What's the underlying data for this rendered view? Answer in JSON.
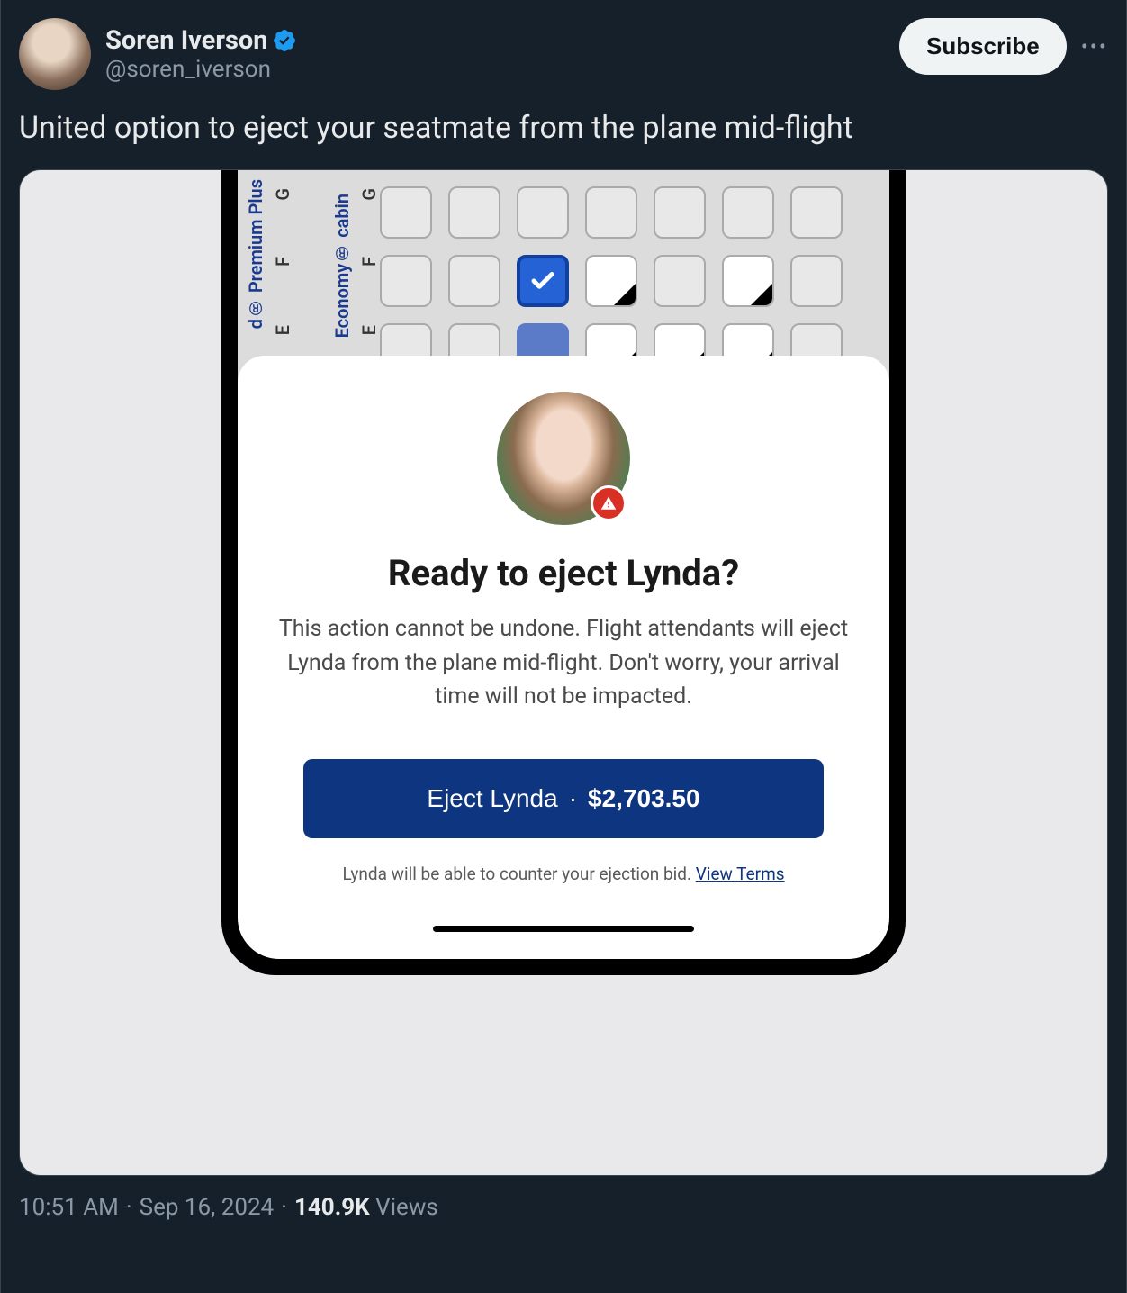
{
  "tweet": {
    "author": {
      "name": "Soren Iverson",
      "handle": "@soren_iverson"
    },
    "text": "United option to eject your seatmate from the plane mid-flight",
    "timestamp": "10:51 AM",
    "date": "Sep 16, 2024",
    "views": "140.9K",
    "views_label": "Views"
  },
  "actions": {
    "subscribe": "Subscribe"
  },
  "phone_ui": {
    "seat_map": {
      "premium_label": "d® Premium Plus",
      "economy_label": "Economy® cabin",
      "row_letters": [
        "G",
        "F",
        "E"
      ]
    },
    "modal": {
      "title": "Ready to eject Lynda?",
      "body": "This action cannot be undone. Flight attendants will eject Lynda from the plane mid-flight. Don't worry, your arrival time will not be impacted.",
      "button_label": "Eject Lynda",
      "button_sep": "·",
      "button_price": "$2,703.50",
      "footer_text": "Lynda will be able to counter your ejection bid. ",
      "footer_link": "View Terms"
    }
  }
}
